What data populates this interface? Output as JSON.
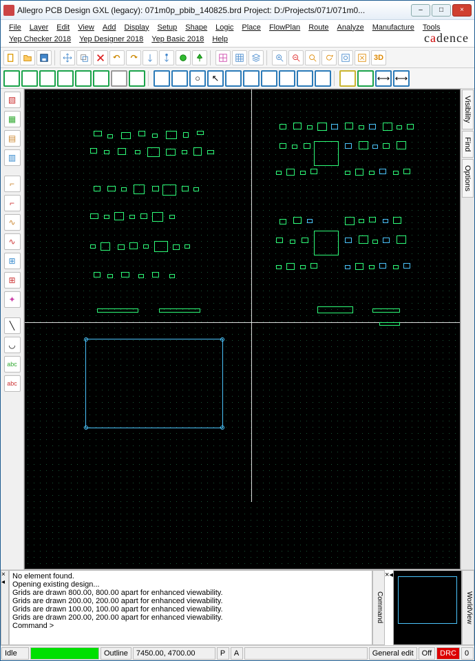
{
  "title": "Allegro PCB Design GXL (legacy): 071m0p_pbib_140825.brd  Project: D:/Projects/071/071m0...",
  "window_buttons": {
    "min": "–",
    "max": "□",
    "close": "×"
  },
  "menu": [
    "File",
    "Layer",
    "Edit",
    "View",
    "Add",
    "Display",
    "Setup",
    "Shape",
    "Logic",
    "Place",
    "FlowPlan",
    "Route",
    "Analyze",
    "Manufacture",
    "Tools",
    "Yep Checker 2018",
    "Yep Designer 2018",
    "Yep Basic 2018",
    "Help"
  ],
  "brand": "cadence",
  "right_tabs": [
    "Visibility",
    "Find",
    "Options"
  ],
  "log": [
    "No element found.",
    "Opening existing design...",
    "Grids are drawn 800.00, 800.00 apart for enhanced viewability.",
    "Grids are drawn 200.00, 200.00 apart for enhanced viewability.",
    "Grids are drawn 100.00, 100.00 apart for enhanced viewability.",
    "Grids are drawn 200.00, 200.00 apart for enhanced viewability.",
    "Command >"
  ],
  "cmd_tab": "Command",
  "wv_tab": "WorldView",
  "status": {
    "idle": "Idle",
    "mode": "Outline",
    "coords": "7450.00, 4700.00",
    "p": "P",
    "a": "A",
    "edit": "General edit",
    "off": "Off",
    "drc": "DRC",
    "zero": "0"
  }
}
